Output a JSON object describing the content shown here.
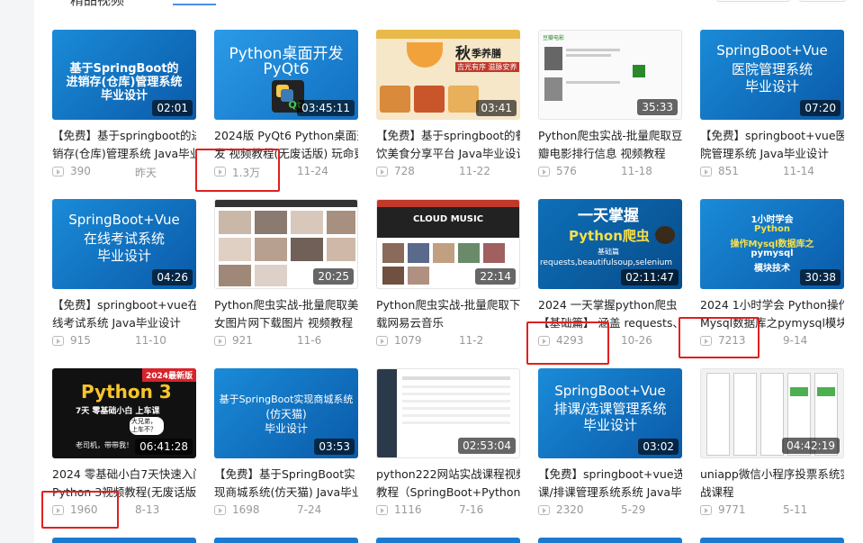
{
  "header": {
    "title": "精品视频"
  },
  "cards": [
    {
      "title": "【免费】基于springboot的进\n销存(仓库)管理系统 Java毕业",
      "views": "390",
      "date": "昨天",
      "duration": "02:01",
      "cover": [
        "基于SpringBoot的",
        "进销存(仓库)管理系统",
        "毕业设计"
      ]
    },
    {
      "title": "2024版 PyQt6 Python桌面开\n发 视频教程(无废话版) 玩命更",
      "views": "1.3万",
      "date": "11-24",
      "duration": "03:45:11",
      "cover": [
        "Python桌面开发",
        "PyQt6",
        "Qt"
      ]
    },
    {
      "title": "【免费】基于springboot的餐\n饮美食分享平台 Java毕业设计",
      "views": "728",
      "date": "11-22",
      "duration": "03:41",
      "cover": [
        "秋",
        "季养膳",
        "吉光有序 滋脉安养"
      ]
    },
    {
      "title": "Python爬虫实战-批量爬取豆\n瓣电影排行信息 视频教程",
      "views": "576",
      "date": "11-18",
      "duration": "35:33",
      "cover": [
        "豆瓣电影"
      ]
    },
    {
      "title": "【免费】springboot+vue医\n院管理系统 Java毕业设计",
      "views": "851",
      "date": "11-14",
      "duration": "07:20",
      "cover": [
        "SpringBoot+Vue",
        "医院管理系统",
        "毕业设计"
      ]
    },
    {
      "title": "【免费】springboot+vue在\n线考试系统 Java毕业设计",
      "views": "915",
      "date": "11-10",
      "duration": "04:26",
      "cover": [
        "SpringBoot+Vue",
        "在线考试系统",
        "毕业设计"
      ]
    },
    {
      "title": "Python爬虫实战-批量爬取美\n女图片网下载图片 视频教程",
      "views": "921",
      "date": "11-6",
      "duration": "20:25",
      "cover": []
    },
    {
      "title": "Python爬虫实战-批量爬取下\n载网易云音乐",
      "views": "1079",
      "date": "11-2",
      "duration": "22:14",
      "cover": [
        "CLOUD MUSIC"
      ]
    },
    {
      "title": "2024 一天掌握python爬虫\n【基础篇】 涵盖 requests、",
      "views": "4293",
      "date": "10-26",
      "duration": "02:11:47",
      "cover": [
        "一天掌握",
        "Python爬虫",
        "基础篇",
        "requests,beautifulsoup,selenium"
      ]
    },
    {
      "title": "2024 1小时学会 Python操作\nMysql数据库之pymysql模块",
      "views": "7213",
      "date": "9-14",
      "duration": "30:38",
      "cover": [
        "1小时学会",
        "Python",
        "操作Mysql数据库之",
        "pymysql",
        "模块技术"
      ]
    },
    {
      "title": "2024 零基础小白7天快速入门\nPython 3视频教程(无废话版)",
      "views": "1960",
      "date": "8-13",
      "duration": "06:41:28",
      "cover": [
        "2024最新版",
        "Python 3",
        "7天 零基础小白 上车课",
        "大兄弟，上车不？",
        "老司机，带带我！"
      ]
    },
    {
      "title": "【免费】基于SpringBoot实\n现商城系统(仿天猫) Java毕业",
      "views": "1698",
      "date": "7-24",
      "duration": "03:53",
      "cover": [
        "基于SpringBoot实现商城系统",
        "(仿天猫)",
        "毕业设计"
      ]
    },
    {
      "title": "python222网站实战课程视频\n教程（SpringBoot+Python",
      "views": "1116",
      "date": "7-16",
      "duration": "02:53:04",
      "cover": []
    },
    {
      "title": "【免费】springboot+vue选\n课/排课管理系统系统 Java毕",
      "views": "2320",
      "date": "5-29",
      "duration": "03:02",
      "cover": [
        "SpringBoot+Vue",
        "排课/选课管理系统",
        "毕业设计"
      ]
    },
    {
      "title": "uniapp微信小程序投票系统实\n战课程",
      "views": "9771",
      "date": "5-11",
      "duration": "04:42:19",
      "cover": []
    }
  ]
}
